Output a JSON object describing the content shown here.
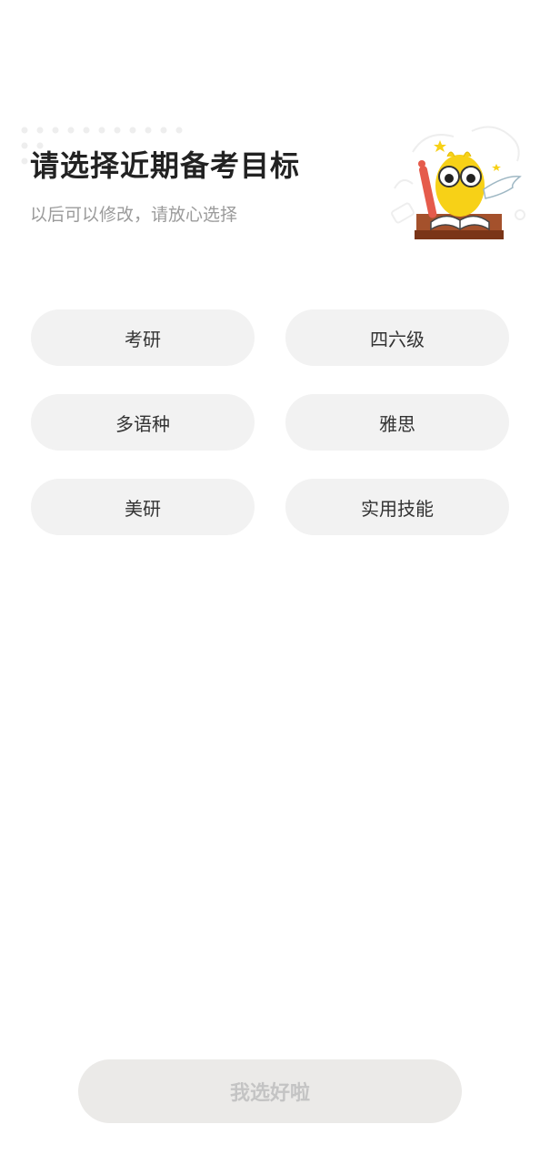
{
  "header": {
    "title": "请选择近期备考目标",
    "subtitle": "以后可以修改，请放心选择",
    "mascot_icon": "yellow-monster-reading-book-icon"
  },
  "options": [
    {
      "label": "考研",
      "selected": false
    },
    {
      "label": "四六级",
      "selected": false
    },
    {
      "label": "多语种",
      "selected": false
    },
    {
      "label": "雅思",
      "selected": false
    },
    {
      "label": "美研",
      "selected": false
    },
    {
      "label": "实用技能",
      "selected": false
    }
  ],
  "footer": {
    "confirm_label": "我选好啦",
    "enabled": false
  },
  "colors": {
    "option_bg": "#f2f2f2",
    "confirm_bg_disabled": "#ebeae8",
    "mascot_yellow": "#f7d117"
  }
}
